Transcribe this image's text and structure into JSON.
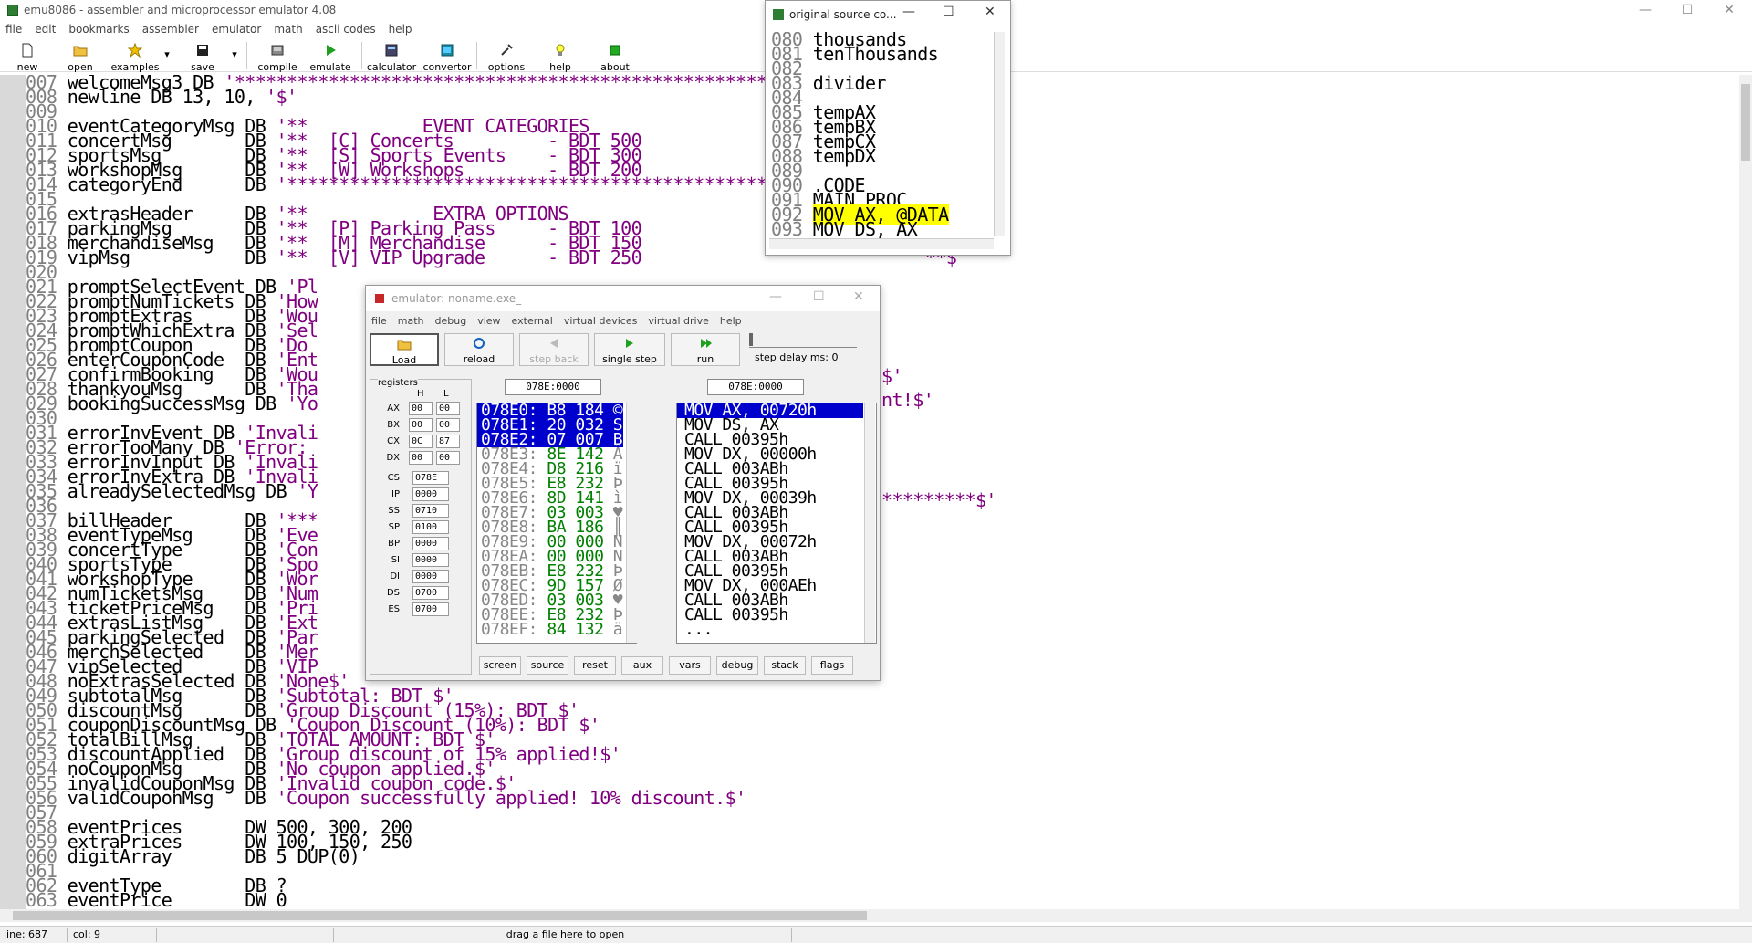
{
  "app": {
    "title": "emu8086 - assembler and microprocessor emulator 4.08",
    "minimize": "—",
    "maximize": "☐",
    "close": "✕"
  },
  "menu": [
    "file",
    "edit",
    "bookmarks",
    "assembler",
    "emulator",
    "math",
    "ascii codes",
    "help"
  ],
  "toolbar": {
    "new": "new",
    "open": "open",
    "examples": "examples",
    "save": "save",
    "compile": "compile",
    "emulate": "emulate",
    "calculator": "calculator",
    "convertor": "convertor",
    "options": "options",
    "help": "help",
    "about": "about",
    "dropdown": "▾"
  },
  "editor": {
    "lines": [
      [
        "007",
        "welcomeMsg3 DB ",
        "'*****************************************************"
      ],
      [
        "008",
        "newline DB 13, 10, ",
        "'$'"
      ],
      [
        "009",
        "",
        ""
      ],
      [
        "010",
        "eventCategoryMsg DB ",
        "'**           EVENT CATEGORIES"
      ],
      [
        "011",
        "concertMsg       DB ",
        "'**  [C] Concerts         - BDT 500"
      ],
      [
        "012",
        "sportsMsg        DB ",
        "'**  [S] Sports Events    - BDT 300"
      ],
      [
        "013",
        "workshopMsg      DB ",
        "'**  [W] Workshops        - BDT 200"
      ],
      [
        "014",
        "categoryEnd      DB ",
        "'****************************************************"
      ],
      [
        "015",
        "",
        ""
      ],
      [
        "016",
        "extrasHeader     DB ",
        "'**            EXTRA OPTIONS"
      ],
      [
        "017",
        "parkingMsg       DB ",
        "'**  [P] Parking Pass     - BDT 100"
      ],
      [
        "018",
        "merchandiseMsg   DB ",
        "'**  [M] Merchandise      - BDT 150"
      ],
      [
        "019",
        "vipMsg           DB ",
        "'**  [V] VIP Upgrade      - BDT 250"
      ],
      [
        "020",
        "",
        ""
      ],
      [
        "021",
        "promptSelectEvent DB ",
        "'Pl"
      ],
      [
        "022",
        "promptNumTickets DB ",
        "'How"
      ],
      [
        "023",
        "promptExtras     DB ",
        "'Wou"
      ],
      [
        "024",
        "promptWhichExtra DB ",
        "'Sel"
      ],
      [
        "025",
        "promptCoupon     DB ",
        "'Do "
      ],
      [
        "026",
        "enterCouponCode  DB ",
        "'Ent"
      ],
      [
        "027",
        "confirmBooking   DB ",
        "'Wou"
      ],
      [
        "028",
        "thankyouMsg      DB ",
        "'Tha"
      ],
      [
        "029",
        "bookingSuccessMsg DB ",
        "'Yo"
      ],
      [
        "030",
        "",
        ""
      ],
      [
        "031",
        "errorInvEvent DB ",
        "'Invali"
      ],
      [
        "032",
        "errorTooMany DB ",
        "'Error: "
      ],
      [
        "033",
        "errorInvInput DB ",
        "'Invali"
      ],
      [
        "034",
        "errorInvExtra DB ",
        "'Invali"
      ],
      [
        "035",
        "alreadySelectedMsg DB ",
        "'Y"
      ],
      [
        "036",
        "",
        ""
      ],
      [
        "037",
        "billHeader       DB ",
        "'***"
      ],
      [
        "038",
        "eventTypeMsg     DB ",
        "'Eve"
      ],
      [
        "039",
        "concertType      DB ",
        "'Con"
      ],
      [
        "040",
        "sportsType       DB ",
        "'Spo"
      ],
      [
        "041",
        "workshopType     DB ",
        "'Wor"
      ],
      [
        "042",
        "numTicketsMsg    DB ",
        "'Num"
      ],
      [
        "043",
        "ticketPriceMsg   DB ",
        "'Pri"
      ],
      [
        "044",
        "extrasListMsg    DB ",
        "'Ext"
      ],
      [
        "045",
        "parkingSelected  DB ",
        "'Par"
      ],
      [
        "046",
        "merchSelected    DB ",
        "'Mer"
      ],
      [
        "047",
        "vipSelected      DB ",
        "'VIP"
      ],
      [
        "048",
        "noExtrasSelected DB ",
        "'None$'"
      ],
      [
        "049",
        "subtotalMsg      DB ",
        "'Subtotal: BDT $'"
      ],
      [
        "050",
        "discountMsg      DB ",
        "'Group Discount (15%): BDT $'"
      ],
      [
        "051",
        "couponDiscountMsg DB ",
        "'Coupon Discount (10%): BDT $'"
      ],
      [
        "052",
        "totalBillMsg     DB ",
        "'TOTAL AMOUNT: BDT $'"
      ],
      [
        "053",
        "discountApplied  DB ",
        "'Group discount of 15% applied!$'"
      ],
      [
        "054",
        "noCouponMsg      DB ",
        "'No coupon applied.$'"
      ],
      [
        "055",
        "invalidCouponMsg DB ",
        "'Invalid coupon code.$'"
      ],
      [
        "056",
        "validCouponMsg   DB ",
        "'Coupon successfully applied! 10% discount.$'"
      ],
      [
        "057",
        "",
        ""
      ],
      [
        "058",
        "eventPrices      DW 500, 300, 200",
        ""
      ],
      [
        "059",
        "extraPrices      DW 100, 150, 250",
        ""
      ],
      [
        "060",
        "digitArray       DB 5 DUP(0)",
        ""
      ],
      [
        "061",
        "",
        ""
      ],
      [
        "062",
        "eventType        DB ?",
        ""
      ],
      [
        "063",
        "eventPrice       DW 0",
        ""
      ]
    ],
    "right_fragments": {
      "l017": "'",
      "l019": "**$'",
      "l027": "$'",
      "l029": "nt!$'",
      "l037": "*********$'"
    }
  },
  "statusbar": {
    "line": "line: 687",
    "col": "col: 9",
    "hint": "drag a file here to open"
  },
  "source_window": {
    "title": "original source co...",
    "lines": [
      [
        "080",
        "thousands",
        ""
      ],
      [
        "081",
        "tenThousands",
        ""
      ],
      [
        "082",
        "",
        ""
      ],
      [
        "083",
        "divider",
        ""
      ],
      [
        "084",
        "",
        ""
      ],
      [
        "085",
        "tempAX",
        ""
      ],
      [
        "086",
        "tempBX",
        ""
      ],
      [
        "087",
        "tempCX",
        ""
      ],
      [
        "088",
        "tempDX",
        ""
      ],
      [
        "089",
        "",
        ""
      ],
      [
        "090",
        ".CODE",
        ""
      ],
      [
        "091",
        "MAIN PROC",
        ""
      ],
      [
        "092",
        "MOV AX, @DATA",
        "hl"
      ],
      [
        "093",
        "MOV DS, AX",
        ""
      ]
    ]
  },
  "emulator": {
    "title": "emulator: noname.exe_",
    "menu": [
      "file",
      "math",
      "debug",
      "view",
      "external",
      "virtual devices",
      "virtual drive",
      "help"
    ],
    "buttons": {
      "load": "Load",
      "reload": "reload",
      "step_back": "step back",
      "single_step": "single step",
      "run": "run"
    },
    "step_delay": "step delay ms: 0",
    "registers_title": "registers",
    "h_label": "H",
    "l_label": "L",
    "regs_hl": [
      {
        "name": "AX",
        "h": "00",
        "l": "00"
      },
      {
        "name": "BX",
        "h": "00",
        "l": "00"
      },
      {
        "name": "CX",
        "h": "0C",
        "l": "87"
      },
      {
        "name": "DX",
        "h": "00",
        "l": "00"
      }
    ],
    "regs_16": [
      {
        "name": "CS",
        "v": "078E"
      },
      {
        "name": "IP",
        "v": "0000"
      },
      {
        "name": "SS",
        "v": "0710"
      },
      {
        "name": "SP",
        "v": "0100"
      },
      {
        "name": "BP",
        "v": "0000"
      },
      {
        "name": "SI",
        "v": "0000"
      },
      {
        "name": "DI",
        "v": "0000"
      },
      {
        "name": "DS",
        "v": "0700"
      },
      {
        "name": "ES",
        "v": "0700"
      }
    ],
    "addr_left": "078E:0000",
    "addr_right": "078E:0000",
    "memory": [
      {
        "addr": "078E0:",
        "hex": "B8",
        "dec": "184",
        "ch": "©",
        "sel": true
      },
      {
        "addr": "078E1:",
        "hex": "20",
        "dec": "032",
        "ch": "S",
        "sel": true
      },
      {
        "addr": "078E2:",
        "hex": "07",
        "dec": "007",
        "ch": "B",
        "sel": true
      },
      {
        "addr": "078E3:",
        "hex": "8E",
        "dec": "142",
        "ch": "Ä",
        "sel": false
      },
      {
        "addr": "078E4:",
        "hex": "D8",
        "dec": "216",
        "ch": "ï",
        "sel": false
      },
      {
        "addr": "078E5:",
        "hex": "E8",
        "dec": "232",
        "ch": "Þ",
        "sel": false
      },
      {
        "addr": "078E6:",
        "hex": "8D",
        "dec": "141",
        "ch": "ì",
        "sel": false
      },
      {
        "addr": "078E7:",
        "hex": "03",
        "dec": "003",
        "ch": "♥",
        "sel": false
      },
      {
        "addr": "078E8:",
        "hex": "BA",
        "dec": "186",
        "ch": "║",
        "sel": false
      },
      {
        "addr": "078E9:",
        "hex": "00",
        "dec": "000",
        "ch": "N",
        "sel": false
      },
      {
        "addr": "078EA:",
        "hex": "00",
        "dec": "000",
        "ch": "N",
        "sel": false
      },
      {
        "addr": "078EB:",
        "hex": "E8",
        "dec": "232",
        "ch": "Þ",
        "sel": false
      },
      {
        "addr": "078EC:",
        "hex": "9D",
        "dec": "157",
        "ch": "Ø",
        "sel": false
      },
      {
        "addr": "078ED:",
        "hex": "03",
        "dec": "003",
        "ch": "♥",
        "sel": false
      },
      {
        "addr": "078EE:",
        "hex": "E8",
        "dec": "232",
        "ch": "Þ",
        "sel": false
      },
      {
        "addr": "078EF:",
        "hex": "84",
        "dec": "132",
        "ch": "ä",
        "sel": false
      }
    ],
    "disasm": [
      {
        "t": "MOV AX, 00720h",
        "sel": true
      },
      {
        "t": "MOV DS, AX",
        "sel": false
      },
      {
        "t": "CALL 00395h",
        "sel": false
      },
      {
        "t": "MOV DX, 00000h",
        "sel": false
      },
      {
        "t": "CALL 003ABh",
        "sel": false
      },
      {
        "t": "CALL 00395h",
        "sel": false
      },
      {
        "t": "MOV DX, 00039h",
        "sel": false
      },
      {
        "t": "CALL 003ABh",
        "sel": false
      },
      {
        "t": "CALL 00395h",
        "sel": false
      },
      {
        "t": "MOV DX, 00072h",
        "sel": false
      },
      {
        "t": "CALL 003ABh",
        "sel": false
      },
      {
        "t": "CALL 00395h",
        "sel": false
      },
      {
        "t": "MOV DX, 000AEh",
        "sel": false
      },
      {
        "t": "CALL 003ABh",
        "sel": false
      },
      {
        "t": "CALL 00395h",
        "sel": false
      },
      {
        "t": "...",
        "sel": false
      }
    ],
    "bottom_buttons": [
      "screen",
      "source",
      "reset",
      "aux",
      "vars",
      "debug",
      "stack",
      "flags"
    ]
  },
  "colors": {
    "string": "#800080",
    "line_number": "#808080",
    "selection": "#0000cc",
    "highlight": "#ffff00",
    "hex_value": "#008000"
  }
}
